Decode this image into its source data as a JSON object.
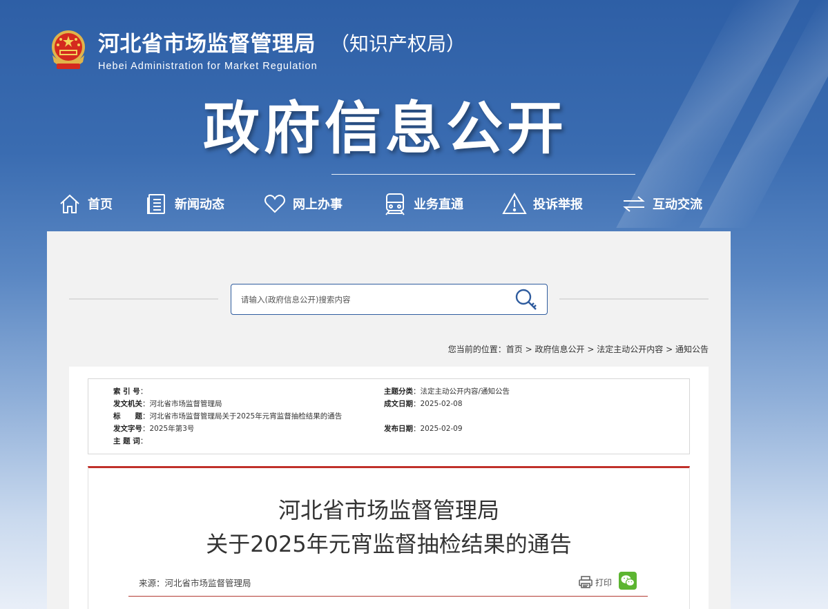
{
  "header": {
    "title_cn": "河北省市场监督管理局",
    "title_sub_cn": "（知识产权局）",
    "title_en": "Hebei Administration for Market Regulation"
  },
  "banner": {
    "title": "政府信息公开"
  },
  "nav": [
    {
      "label": "首页",
      "icon": "home-icon"
    },
    {
      "label": "新闻动态",
      "icon": "news-icon"
    },
    {
      "label": "网上办事",
      "icon": "heart-icon"
    },
    {
      "label": "业务直通",
      "icon": "train-icon"
    },
    {
      "label": "投诉举报",
      "icon": "warning-icon"
    },
    {
      "label": "互动交流",
      "icon": "exchange-icon"
    }
  ],
  "search": {
    "placeholder": "请输入(政府信息公开)搜索内容",
    "value": ""
  },
  "breadcrumb": {
    "prefix": "您当前的位置：",
    "items": [
      "首页",
      "政府信息公开",
      "法定主动公开内容",
      "通知公告"
    ],
    "separator": ">"
  },
  "meta": {
    "index_no": {
      "label": "索 引 号",
      "value": ""
    },
    "category": {
      "label": "主题分类",
      "value": "法定主动公开内容/通知公告"
    },
    "issuer": {
      "label": "发文机关",
      "value": "河北省市场监督管理局"
    },
    "created": {
      "label": "成文日期",
      "value": "2025-02-08"
    },
    "title": {
      "label": "标　　题",
      "value": "河北省市场监督管理局关于2025年元宵监督抽检结果的通告"
    },
    "doc_no": {
      "label": "发文字号",
      "value": "2025年第3号"
    },
    "published": {
      "label": "发布日期",
      "value": "2025-02-09"
    },
    "keywords": {
      "label": "主 题 词",
      "value": ""
    }
  },
  "article": {
    "title_line1": "河北省市场监督管理局",
    "title_line2": "关于2025年元宵监督抽检结果的通告",
    "source": "来源：河北省市场监督管理局",
    "print_label": "打印"
  },
  "colors": {
    "brand_blue": "#2f5c9e",
    "accent_red": "#c0302a",
    "wechat_green": "#5cb531"
  }
}
